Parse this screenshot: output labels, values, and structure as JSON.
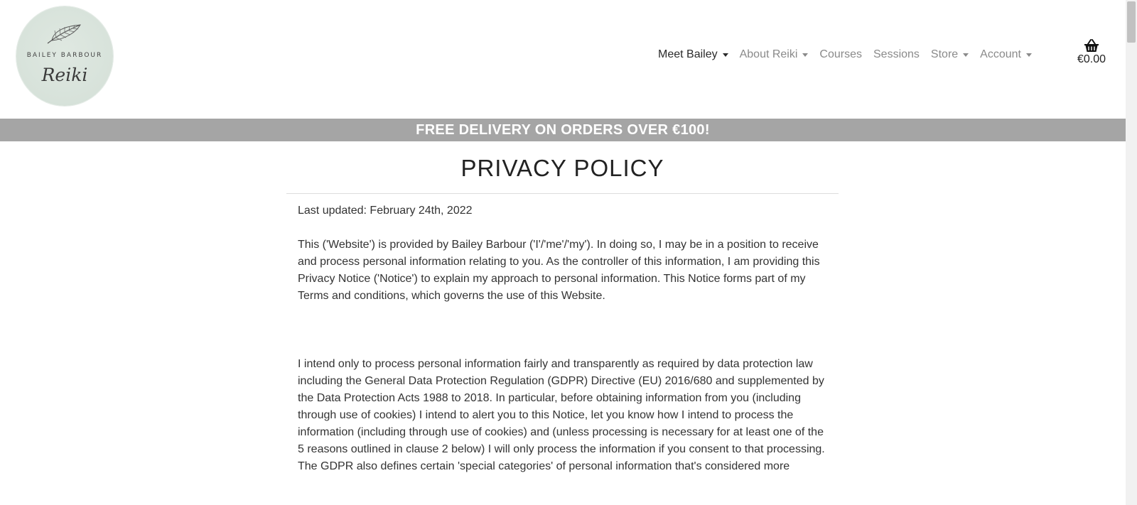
{
  "logo": {
    "top_text": "BAILEY BARBOUR",
    "script_text": "Reiki"
  },
  "nav": {
    "items": [
      {
        "label": "Meet Bailey",
        "dropdown": true,
        "active": true
      },
      {
        "label": "About Reiki",
        "dropdown": true,
        "active": false
      },
      {
        "label": "Courses",
        "dropdown": false,
        "active": false
      },
      {
        "label": "Sessions",
        "dropdown": false,
        "active": false
      },
      {
        "label": "Store",
        "dropdown": true,
        "active": false
      },
      {
        "label": "Account",
        "dropdown": true,
        "active": false
      }
    ],
    "cart_total": "€0.00",
    "cart_icon": "basket-icon"
  },
  "banner": {
    "text": "FREE DELIVERY ON ORDERS OVER €100!"
  },
  "content": {
    "title": "PRIVACY POLICY",
    "last_updated": "Last updated: February 24th, 2022",
    "paragraph_1": "This ('Website') is provided by Bailey Barbour ('I'/'me'/'my'). In doing so, I may be in a position to receive and process personal information relating to you. As the controller of this information, I am providing this Privacy Notice ('Notice') to explain my approach to personal information. This Notice forms part of my Terms and conditions, which governs the use of this Website.",
    "paragraph_2": "I intend only to process personal information fairly and transparently as required by data protection law including the General Data Protection Regulation (GDPR) Directive (EU) 2016/680 and supplemented by the Data Protection Acts 1988 to 2018. In particular, before obtaining information from you (including through use of cookies) I intend to alert you to this Notice, let you know how I intend to process the information (including through use of cookies) and (unless processing is necessary for at least one of the 5 reasons outlined in clause 2 below) I will only process the information if you consent to that processing. The GDPR also defines certain 'special categories' of personal information that's considered more"
  },
  "colors": {
    "banner_bg": "#a5a5a5",
    "logo_bg": "#d7e2da",
    "nav_active": "#2a2a2a",
    "nav_inactive": "#8a8a8a"
  }
}
